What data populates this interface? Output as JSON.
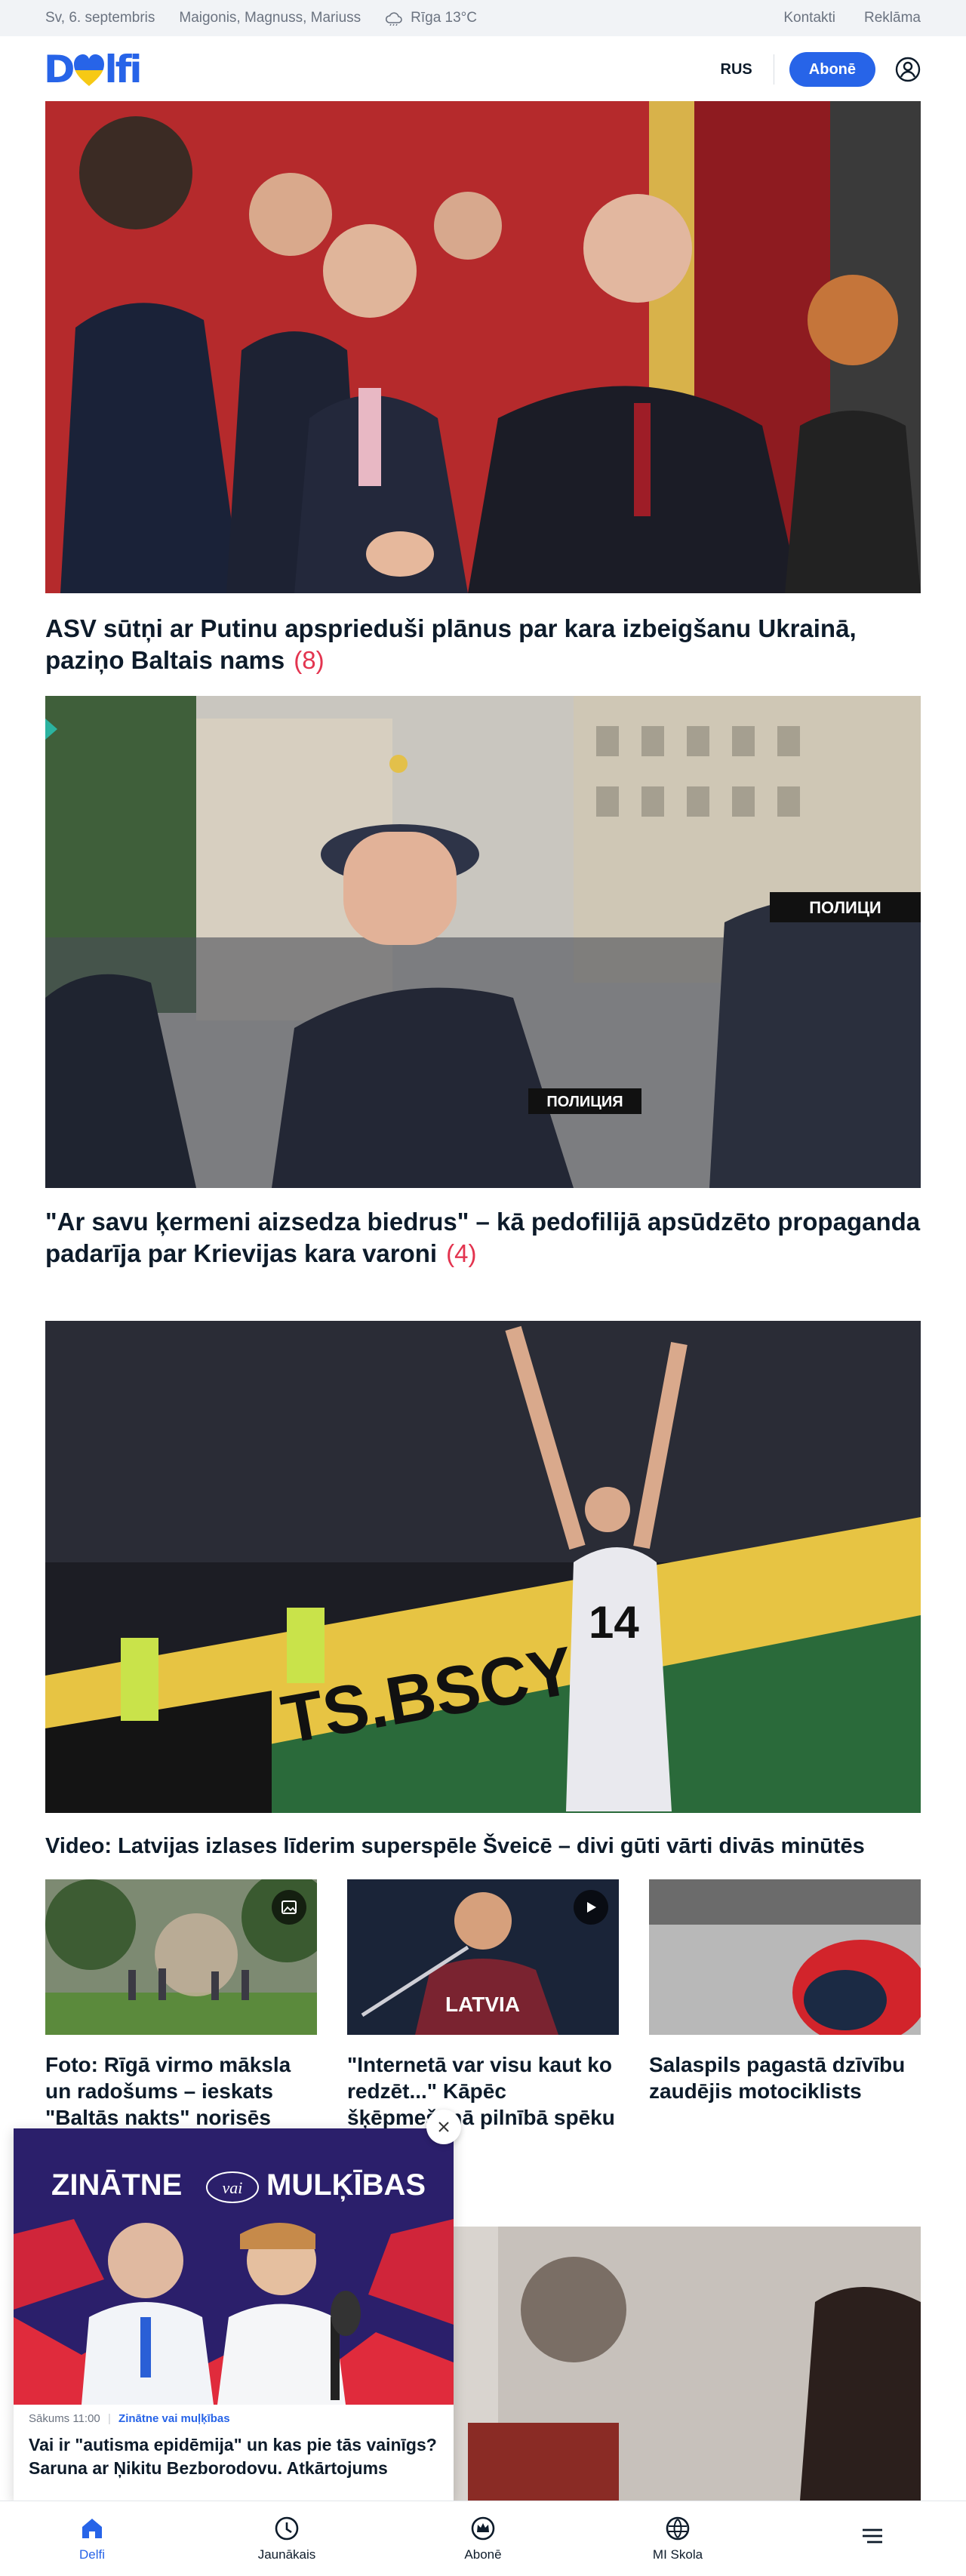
{
  "topbar": {
    "date": "Sv, 6. septembris",
    "namedays": "Maigonis, Magnuss, Mariuss",
    "weather": "Rīga 13°C",
    "links": [
      "Kontakti",
      "Reklāma"
    ]
  },
  "header": {
    "logo": "Delfi",
    "lang": "RUS",
    "subscribe": "Abonē"
  },
  "articles": [
    {
      "title": "ASV sūtņi ar Putinu apsprieduši plānus par kara izbeigšanu Ukrainā, paziņo Baltais nams",
      "comments": "(8)"
    },
    {
      "title": "\"Ar savu ķermeni aizsedza biedrus\" – kā pedofilijā apsūdzēto propaganda padarīja par Krievijas kara varoni",
      "comments": "(4)"
    },
    {
      "title": "Video: Latvijas izlases līderim superspēle Šveicē – divi gūti vārti divās minūtēs"
    }
  ],
  "cards": [
    {
      "title": "Foto: Rīgā virmo māksla un radošums – ieskats \"Baltās nakts\" norisēs",
      "badge": "image-icon"
    },
    {
      "title": "\"Internetā var visu kaut ko redzēt...\" Kāpēc šķēpmešanā pilnībā spēku samēri?",
      "badge": "play-icon"
    },
    {
      "title": "Salaspils pagastā dzīvību zaudējis motociklists"
    }
  ],
  "promo": {
    "banner_left": "ZINĀTNE",
    "banner_mid": "vai",
    "banner_right": "MULĶĪBAS",
    "time": "Sākums 11:00",
    "category": "Zinātne vai muļķības",
    "title": "Vai ir \"autisma epidēmija\" un kas pie tās vainīgs? Saruna ar Ņikitu Bezborodovu. Atkārtojums"
  },
  "bottom_nav": [
    {
      "label": "Delfi",
      "icon": "home-icon"
    },
    {
      "label": "Jaunākais",
      "icon": "clock-icon"
    },
    {
      "label": "Abonē",
      "icon": "crown-icon"
    },
    {
      "label": "MI Skola",
      "icon": "ai-icon"
    },
    {
      "label": "",
      "icon": "menu-icon"
    }
  ],
  "colors": {
    "accent": "#2764e8",
    "comments": "#e3344f"
  }
}
